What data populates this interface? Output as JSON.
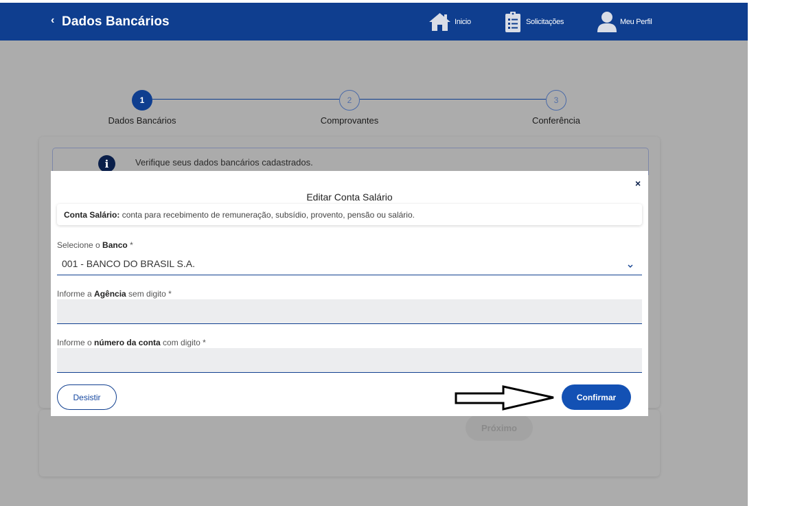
{
  "header": {
    "back_glyph": "‹",
    "title": "Dados Bancários",
    "nav": [
      {
        "label": "Inicio",
        "icon": "home-icon"
      },
      {
        "label": "Solicitações",
        "icon": "clipboard-list-icon"
      },
      {
        "label": "Meu Perfil",
        "icon": "user-icon"
      }
    ]
  },
  "stepper": {
    "steps": [
      {
        "number": "1",
        "label": "Dados Bancários",
        "active": true
      },
      {
        "number": "2",
        "label": "Comprovantes",
        "active": false
      },
      {
        "number": "3",
        "label": "Conferência",
        "active": false
      }
    ]
  },
  "info": {
    "icon_glyph": "i",
    "text": "Verifique seus dados bancários cadastrados."
  },
  "background_actions": {
    "next_label": "Próximo"
  },
  "modal": {
    "title": "Editar Conta Salário",
    "close_glyph": "×",
    "hint_bold": "Conta Salário:",
    "hint_text": " conta para recebimento de remuneração, subsídio, provento, pensão ou salário.",
    "bank_label_pre": "Selecione o ",
    "bank_label_bold": "Banco",
    "bank_label_post": " *",
    "bank_value": "001 - BANCO DO BRASIL S.A.",
    "agency_label_pre": "Informe a ",
    "agency_label_bold": "Agência",
    "agency_label_post": " sem digito *",
    "agency_value": "",
    "account_label_pre": "Informe o ",
    "account_label_bold": "número da conta",
    "account_label_post": " com digito *",
    "account_value": "",
    "cancel_label": "Desistir",
    "confirm_label": "Confirmar"
  },
  "colors": {
    "header_bg": "#0f3e8f",
    "primary_button": "#1351b4",
    "overlay": "#acacac"
  }
}
